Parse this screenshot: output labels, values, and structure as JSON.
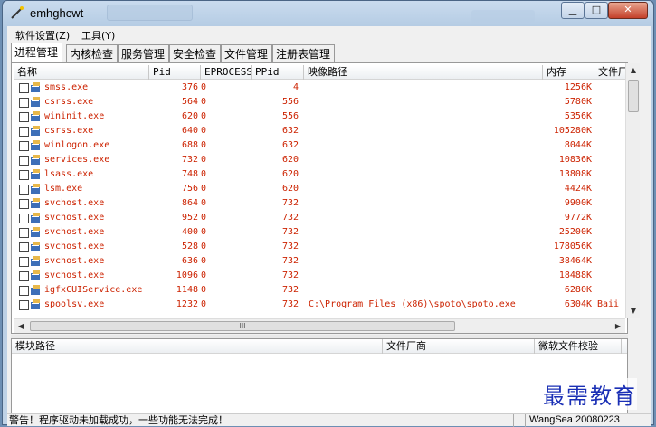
{
  "window": {
    "title": "emhghcwt"
  },
  "titlebar_buttons": {
    "minimize": "▁",
    "maximize": "□",
    "close": "✕"
  },
  "menubar": [
    {
      "label": "软件设置(Z)"
    },
    {
      "label": "工具(Y)"
    }
  ],
  "tabs": [
    {
      "label": "进程管理",
      "active": true
    },
    {
      "label": "内核检查"
    },
    {
      "label": "服务管理"
    },
    {
      "label": "安全检查"
    },
    {
      "label": "文件管理"
    },
    {
      "label": "注册表管理"
    }
  ],
  "process_list": {
    "columns": [
      "名称",
      "Pid",
      "EPROCESS",
      "PPid",
      "映像路径",
      "内存",
      "文件厂"
    ],
    "rows": [
      {
        "name": "smss.exe",
        "pid": "376",
        "eprocess": "0",
        "ppid": "4",
        "path": "",
        "memory": "1256K",
        "vendor": ""
      },
      {
        "name": "csrss.exe",
        "pid": "564",
        "eprocess": "0",
        "ppid": "556",
        "path": "",
        "memory": "5780K",
        "vendor": ""
      },
      {
        "name": "wininit.exe",
        "pid": "620",
        "eprocess": "0",
        "ppid": "556",
        "path": "",
        "memory": "5356K",
        "vendor": ""
      },
      {
        "name": "csrss.exe",
        "pid": "640",
        "eprocess": "0",
        "ppid": "632",
        "path": "",
        "memory": "105280K",
        "vendor": ""
      },
      {
        "name": "winlogon.exe",
        "pid": "688",
        "eprocess": "0",
        "ppid": "632",
        "path": "",
        "memory": "8044K",
        "vendor": ""
      },
      {
        "name": "services.exe",
        "pid": "732",
        "eprocess": "0",
        "ppid": "620",
        "path": "",
        "memory": "10836K",
        "vendor": ""
      },
      {
        "name": "lsass.exe",
        "pid": "748",
        "eprocess": "0",
        "ppid": "620",
        "path": "",
        "memory": "13808K",
        "vendor": ""
      },
      {
        "name": "lsm.exe",
        "pid": "756",
        "eprocess": "0",
        "ppid": "620",
        "path": "",
        "memory": "4424K",
        "vendor": ""
      },
      {
        "name": "svchost.exe",
        "pid": "864",
        "eprocess": "0",
        "ppid": "732",
        "path": "",
        "memory": "9900K",
        "vendor": ""
      },
      {
        "name": "svchost.exe",
        "pid": "952",
        "eprocess": "0",
        "ppid": "732",
        "path": "",
        "memory": "9772K",
        "vendor": ""
      },
      {
        "name": "svchost.exe",
        "pid": "400",
        "eprocess": "0",
        "ppid": "732",
        "path": "",
        "memory": "25200K",
        "vendor": ""
      },
      {
        "name": "svchost.exe",
        "pid": "528",
        "eprocess": "0",
        "ppid": "732",
        "path": "",
        "memory": "178056K",
        "vendor": ""
      },
      {
        "name": "svchost.exe",
        "pid": "636",
        "eprocess": "0",
        "ppid": "732",
        "path": "",
        "memory": "38464K",
        "vendor": ""
      },
      {
        "name": "svchost.exe",
        "pid": "1096",
        "eprocess": "0",
        "ppid": "732",
        "path": "",
        "memory": "18488K",
        "vendor": ""
      },
      {
        "name": "igfxCUIService.exe",
        "pid": "1148",
        "eprocess": "0",
        "ppid": "732",
        "path": "",
        "memory": "6280K",
        "vendor": ""
      },
      {
        "name": "spoolsv.exe",
        "pid": "1232",
        "eprocess": "0",
        "ppid": "732",
        "path": "C:\\Program Files (x86)\\spoto\\spoto.exe",
        "memory": "6304K",
        "vendor": "Baii"
      }
    ]
  },
  "module_list": {
    "columns": [
      "模块路径",
      "文件厂商",
      "微软文件校验"
    ]
  },
  "scroll": {
    "h_thumb_glyph": "III"
  },
  "status": {
    "message": "警告！程序驱动未加载成功，一些功能无法完成！",
    "version": "WangSea 20080223"
  },
  "watermark": "最需教育",
  "colors": {
    "process_text": "#cc2200",
    "watermark": "#1a2fb5"
  }
}
